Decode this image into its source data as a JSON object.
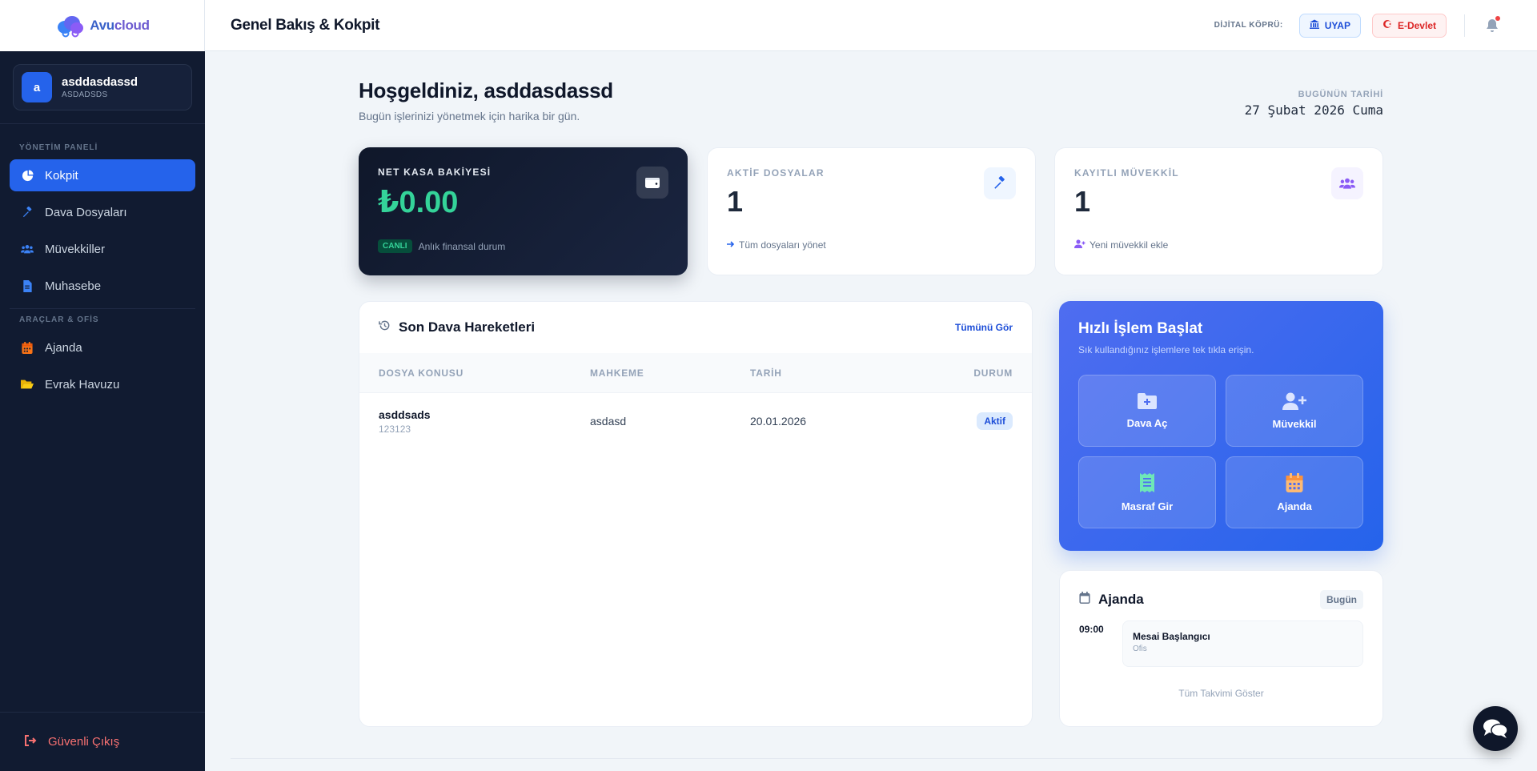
{
  "brand": {
    "name_part1": "Avu",
    "name_part2": "cloud"
  },
  "user": {
    "initial": "a",
    "name": "asddasdassd",
    "subtitle": "ASDADSDS"
  },
  "sidebar": {
    "section1": "YÖNETİM PANELİ",
    "section2": "ARAÇLAR & OFİS",
    "items": [
      {
        "label": "Kokpit",
        "icon": "pie-chart-icon",
        "active": true
      },
      {
        "label": "Dava Dosyaları",
        "icon": "gavel-icon"
      },
      {
        "label": "Müvekkiller",
        "icon": "users-icon"
      },
      {
        "label": "Muhasebe",
        "icon": "invoice-icon"
      },
      {
        "label": "Ajanda",
        "icon": "calendar-icon"
      },
      {
        "label": "Evrak Havuzu",
        "icon": "folder-open-icon"
      }
    ],
    "logout": "Güvenli Çıkış"
  },
  "header": {
    "title": "Genel Bakış & Kokpit",
    "bridge_label": "DİJİTAL KÖPRÜ:",
    "uyap": "UYAP",
    "edevlet": "E-Devlet"
  },
  "welcome": {
    "title": "Hoşgeldiniz, asddasdassd",
    "subtitle": "Bugün işlerinizi yönetmek için harika bir gün.",
    "date_label": "BUGÜNÜN TARİHİ",
    "date_value": "27 Şubat 2026 Cuma"
  },
  "stats": {
    "balance": {
      "label": "NET KASA BAKİYESİ",
      "value": "₺0.00",
      "badge": "CANLI",
      "foot": "Anlık finansal durum"
    },
    "files": {
      "label": "AKTİF DOSYALAR",
      "value": "1",
      "foot": "Tüm dosyaları yönet"
    },
    "clients": {
      "label": "KAYITLI MÜVEKKİL",
      "value": "1",
      "foot": "Yeni müvekkil ekle"
    }
  },
  "recent": {
    "title": "Son Dava Hareketleri",
    "see_all": "Tümünü Gör",
    "columns": [
      "DOSYA KONUSU",
      "MAHKEME",
      "TARİH",
      "DURUM"
    ],
    "rows": [
      {
        "subject": "asddsads",
        "number": "123123",
        "court": "asdasd",
        "date": "20.01.2026",
        "status": "Aktif"
      }
    ]
  },
  "quick": {
    "title": "Hızlı İşlem Başlat",
    "subtitle": "Sık kullandığınız işlemlere tek tıkla erişin.",
    "actions": [
      "Dava Aç",
      "Müvekkil",
      "Masraf Gir",
      "Ajanda"
    ]
  },
  "agenda": {
    "title": "Ajanda",
    "today": "Bugün",
    "items": [
      {
        "time": "09:00",
        "title": "Mesai Başlangıcı",
        "sub": "Ofis"
      }
    ],
    "show_all": "Tüm Takvimi Göster"
  },
  "colors": {
    "accent": "#2563eb",
    "sidebar_bg": "#111b31",
    "success": "#34d399",
    "danger": "#ef4444"
  }
}
